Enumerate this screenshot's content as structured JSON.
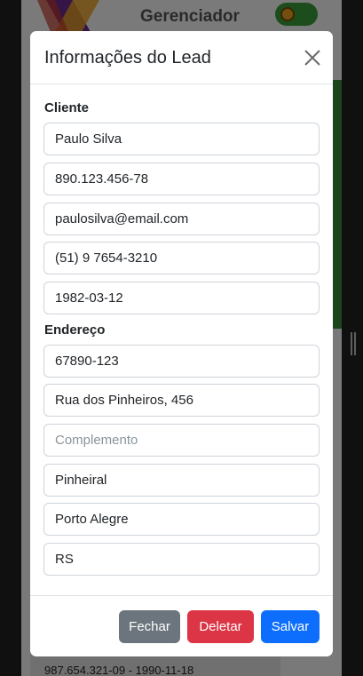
{
  "app": {
    "title": "Gerenciador",
    "background_item": "987.654.321-09 - 1990-11-18"
  },
  "modal": {
    "title": "Informações do Lead",
    "client_section": "Cliente",
    "address_section": "Endereço",
    "fields": {
      "name": "Paulo Silva",
      "cpf": "890.123.456-78",
      "email": "paulosilva@email.com",
      "phone": "(51) 9 7654-3210",
      "birthdate": "1982-03-12",
      "cep": "67890-123",
      "street": "Rua dos Pinheiros, 456",
      "complement": "",
      "complement_placeholder": "Complemento",
      "neighborhood": "Pinheiral",
      "city": "Porto Alegre",
      "state": "RS"
    },
    "buttons": {
      "close": "Fechar",
      "delete": "Deletar",
      "save": "Salvar"
    }
  },
  "colors": {
    "close_button": "#6c757d",
    "delete_button": "#dc3545",
    "save_button": "#0d6efd"
  }
}
